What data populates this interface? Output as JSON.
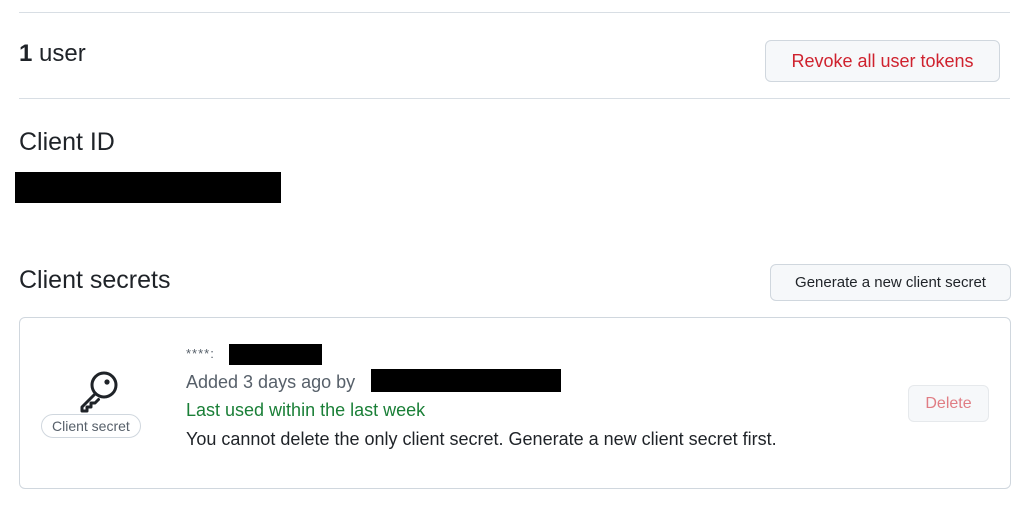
{
  "users": {
    "count": "1",
    "label": "user"
  },
  "actions": {
    "revoke_label": "Revoke all user tokens",
    "generate_label": "Generate a new client secret"
  },
  "client_id": {
    "title": "Client ID"
  },
  "client_secrets": {
    "title": "Client secrets",
    "items": [
      {
        "masked_prefix": "****:",
        "added_text": "Added 3 days ago by",
        "last_used": "Last used within the last week",
        "warning": "You cannot delete the only client secret. Generate a new client secret first.",
        "badge": "Client secret",
        "icon": "key-icon",
        "delete_label": "Delete"
      }
    ]
  },
  "colors": {
    "danger": "#cf222e",
    "success": "#1a7f37",
    "muted": "#57606a",
    "border": "#d0d7de",
    "button_bg": "#f6f8fa"
  }
}
